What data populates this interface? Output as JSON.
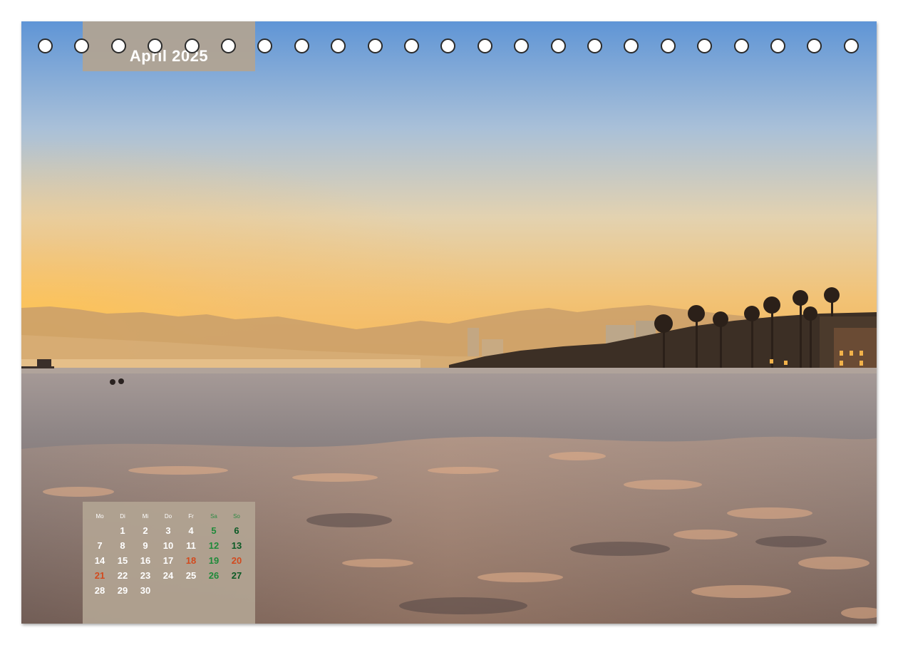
{
  "calendar": {
    "month_title": "April 2025",
    "weekdays": [
      "Mo",
      "Di",
      "Mi",
      "Do",
      "Fr",
      "Sa",
      "So"
    ],
    "weeks": [
      [
        "",
        "1",
        "2",
        "3",
        "4",
        "5",
        "6"
      ],
      [
        "7",
        "8",
        "9",
        "10",
        "11",
        "12",
        "13"
      ],
      [
        "14",
        "15",
        "16",
        "17",
        "18",
        "19",
        "20"
      ],
      [
        "21",
        "22",
        "23",
        "24",
        "25",
        "26",
        "27"
      ],
      [
        "28",
        "29",
        "30",
        "",
        "",
        "",
        ""
      ]
    ],
    "holidays": [
      "18",
      "20",
      "21"
    ]
  },
  "binding": {
    "hole_count": 23
  },
  "colors": {
    "panel": "#b2a492",
    "saturday": "#1f8a3a",
    "sunday": "#0b5a25",
    "holiday": "#d24a1e"
  }
}
